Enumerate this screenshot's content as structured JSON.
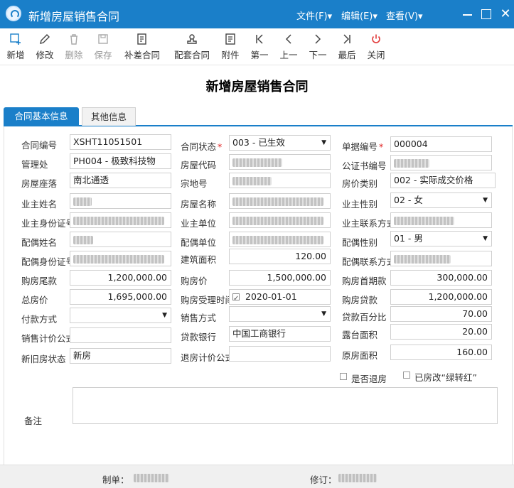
{
  "window": {
    "title": "新增房屋销售合同"
  },
  "menu": {
    "file": "文件(F)▾",
    "edit": "编辑(E)▾",
    "view": "查看(V)▾"
  },
  "toolbar": {
    "add": "新增",
    "modify": "修改",
    "delete": "删除",
    "save": "保存",
    "supplement": "补差合同",
    "match": "配套合同",
    "attachment": "附件",
    "first": "第一",
    "prev": "上一",
    "next": "下一",
    "last": "最后",
    "close": "关闭"
  },
  "heading": "新增房屋销售合同",
  "tabs": {
    "basic": "合同基本信息",
    "other": "其他信息"
  },
  "labels": {
    "contract_no": "合同编号",
    "contract_status": "合同状态",
    "bill_no": "单据编号",
    "office": "管理处",
    "house_code": "房屋代码",
    "notary_no": "公证书编号",
    "house_location": "房屋座落",
    "lot_no": "宗地号",
    "price_type": "房价类别",
    "owner_name": "业主姓名",
    "house_name": "房屋名称",
    "owner_gender": "业主性别",
    "owner_id": "业主身份证号",
    "owner_unit": "业主单位",
    "owner_contact": "业主联系方式",
    "spouse_name": "配偶姓名",
    "spouse_unit": "配偶单位",
    "spouse_gender": "配偶性别",
    "spouse_id": "配偶身份证号",
    "building_area": "建筑面积",
    "spouse_contact": "配偶联系方式",
    "final_payment": "购房尾款",
    "house_price": "购房价",
    "down_payment": "购房首期款",
    "total_price": "总房价",
    "accept_time": "购房受理时间",
    "loan": "购房贷款",
    "pay_method": "付款方式",
    "sale_method": "销售方式",
    "loan_percent": "贷款百分比",
    "sale_formula": "销售计价公式",
    "loan_bank": "贷款银行",
    "terrace_area": "露台面积",
    "house_state": "新旧房状态",
    "refund_formula": "退房计价公式",
    "original_area": "原房面积",
    "is_refund": "是否退房",
    "green_red": "已房改“绿转红”",
    "remark": "备注"
  },
  "values": {
    "contract_no": "XSHT11051501",
    "contract_status": "003 - 已生效",
    "bill_no": "000004",
    "office": "PH004 - 极致科技物",
    "house_location": "南北通透",
    "price_type": "002 - 实际成交价格",
    "owner_gender": "02 - 女",
    "spouse_gender": "01 - 男",
    "building_area": "120.00",
    "final_payment": "1,200,000.00",
    "house_price": "1,500,000.00",
    "down_payment": "300,000.00",
    "total_price": "1,695,000.00",
    "accept_time": "2020-01-01",
    "loan": "1,200,000.00",
    "pay_method": "",
    "sale_method": "",
    "loan_percent": "70.00",
    "sale_formula": "",
    "loan_bank": "中国工商银行",
    "terrace_area": "20.00",
    "house_state": "新房",
    "refund_formula": "",
    "original_area": "160.00"
  },
  "footer": {
    "creator": "制单：",
    "reviser": "修订："
  },
  "colors": {
    "accent": "#1a7fc9",
    "required": "#e02020"
  }
}
